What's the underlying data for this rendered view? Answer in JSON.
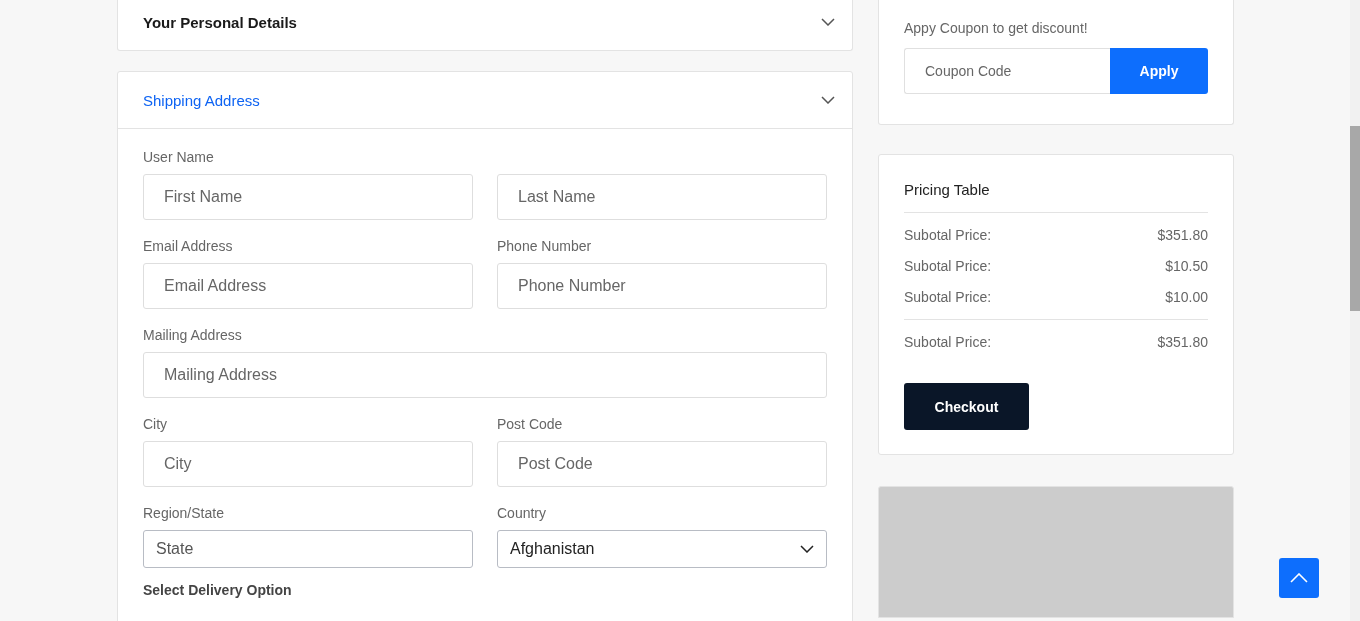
{
  "sections": [
    {
      "title": "Your Personal Details",
      "expanded": false
    },
    {
      "title": "Shipping Address",
      "expanded": true,
      "rows": [
        {
          "label": "User Name",
          "fields": [
            {
              "kind": "input",
              "placeholder": "First Name"
            },
            {
              "kind": "input",
              "placeholder": "Last Name"
            }
          ]
        },
        {
          "labels": [
            "Email Address",
            "Phone Number"
          ],
          "fields": [
            {
              "kind": "input",
              "placeholder": "Email Address"
            },
            {
              "kind": "input",
              "placeholder": "Phone Number"
            }
          ]
        },
        {
          "label": "Mailing Address",
          "fields": [
            {
              "kind": "input",
              "placeholder": "Mailing Address"
            }
          ]
        },
        {
          "labels": [
            "City",
            "Post Code"
          ],
          "fields": [
            {
              "kind": "input",
              "placeholder": "City"
            },
            {
              "kind": "input",
              "placeholder": "Post Code"
            }
          ]
        },
        {
          "labels": [
            "Region/State",
            "Country"
          ],
          "fields": [
            {
              "kind": "compact",
              "placeholder": "State"
            },
            {
              "kind": "select",
              "value": "Afghanistan"
            }
          ]
        }
      ],
      "subheading": "Select Delivery Option"
    }
  ],
  "coupon": {
    "text": "Appy Coupon to get discount!",
    "placeholder": "Coupon Code",
    "button": "Apply"
  },
  "pricing": {
    "title": "Pricing Table",
    "rows": [
      {
        "label": "Subotal Price:",
        "value": "$351.80"
      },
      {
        "label": "Subotal Price:",
        "value": "$10.50"
      },
      {
        "label": "Subotal Price:",
        "value": "$10.00"
      }
    ],
    "total": {
      "label": "Subotal Price:",
      "value": "$351.80"
    },
    "button": "Checkout"
  },
  "side_panel": {
    "kind": "placeholder"
  }
}
